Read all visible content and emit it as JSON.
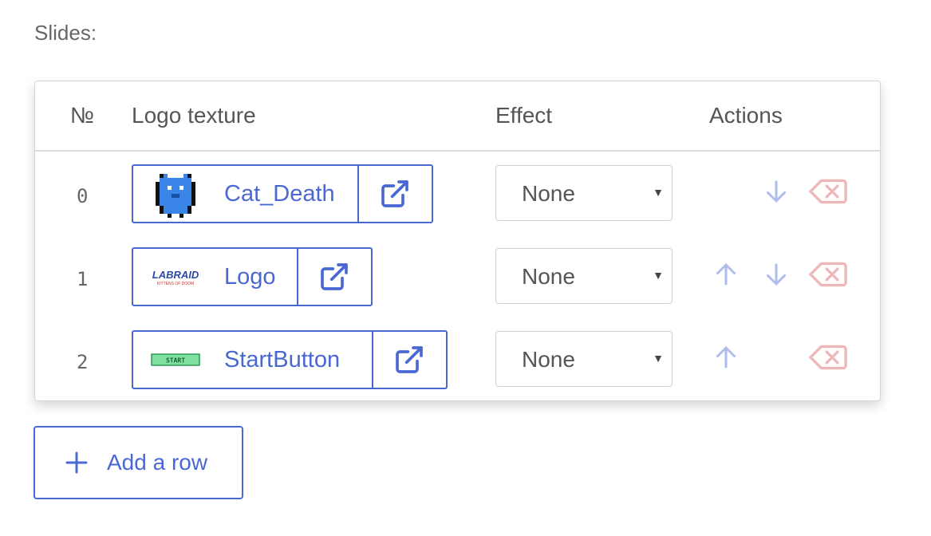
{
  "section_label": "Slides:",
  "table": {
    "headers": {
      "number": "№",
      "logo": "Logo texture",
      "effect": "Effect",
      "actions": "Actions"
    },
    "rows": [
      {
        "index": "0",
        "texture_name": "Cat_Death",
        "thumbnail": "cat-sprite",
        "effect": "None",
        "can_move_up": false,
        "can_move_down": true
      },
      {
        "index": "1",
        "texture_name": "Logo",
        "thumbnail": "labraid-logo",
        "thumbnail_text": "LABRAID",
        "thumbnail_subtext": "KITTENS OF DOOM",
        "effect": "None",
        "can_move_up": true,
        "can_move_down": true
      },
      {
        "index": "2",
        "texture_name": "StartButton",
        "thumbnail": "start-button",
        "thumbnail_text": "START",
        "effect": "None",
        "can_move_up": true,
        "can_move_down": false
      }
    ]
  },
  "add_row_label": "Add a row",
  "icons": {
    "open": "external-link-icon",
    "up": "arrow-up-icon",
    "down": "arrow-down-icon",
    "delete": "backspace-icon",
    "add": "plus-icon",
    "caret": "caret-down-icon"
  },
  "colors": {
    "accent": "#4a68d4",
    "arrow": "#aebdea",
    "delete": "#eeb8bb",
    "text": "#555555"
  }
}
